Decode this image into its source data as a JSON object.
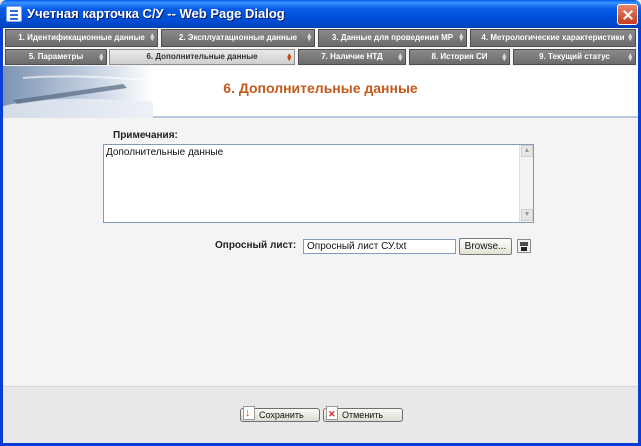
{
  "window": {
    "title": "Учетная карточка С/У -- Web Page Dialog"
  },
  "tabs_row1": [
    {
      "label": "1. Идентификационные данные"
    },
    {
      "label": "2. Эксплуатационные данные"
    },
    {
      "label": "3. Данные для проведения МР"
    },
    {
      "label": "4. Метрологические характеристики"
    }
  ],
  "tabs_row2": [
    {
      "label": "5. Параметры"
    },
    {
      "label": "6. Дополнительные данные",
      "active": true
    },
    {
      "label": "7. Наличие НТД"
    },
    {
      "label": "8. История СИ"
    },
    {
      "label": "9. Текущий статус"
    }
  ],
  "page": {
    "title": "6. Дополнительные данные"
  },
  "notes": {
    "label": "Примечания:",
    "value": "Дополнительные данные"
  },
  "questionnaire": {
    "label": "Опросный лист:",
    "value": "Опросный лист СУ.txt",
    "browse_label": "Browse..."
  },
  "footer": {
    "save_label": "Сохранить",
    "cancel_label": "Отменить"
  },
  "colors": {
    "title_accent": "#C35A1B",
    "titlebar": "#0A5CE8",
    "tab_bg": "#7A7A7A"
  }
}
